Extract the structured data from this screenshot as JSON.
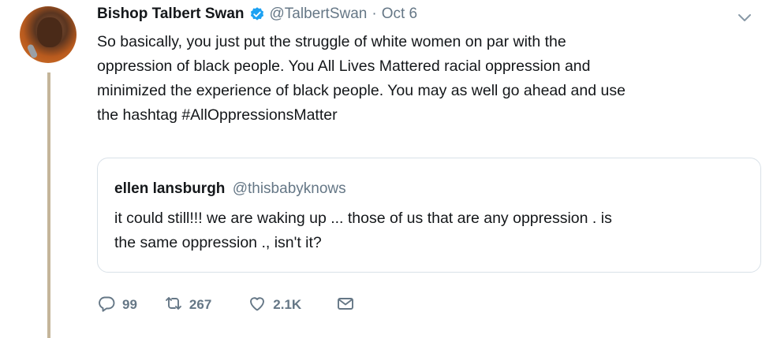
{
  "author": {
    "name": "Bishop Talbert Swan",
    "handle": "@TalbertSwan",
    "separator": "·",
    "date": "Oct 6"
  },
  "tweet": {
    "lines": [
      "So basically, you just put the struggle of white women on par with the",
      "oppression of black people. You All Lives Mattered racial oppression and",
      "minimized the experience of black people. You may as well go ahead and use",
      "the hashtag #AllOppressionsMatter"
    ]
  },
  "quoted": {
    "name": "ellen lansburgh",
    "handle": "@thisbabyknows",
    "lines": [
      "it could still!!! we are waking up ... those of us that are any oppression . is",
      "the same oppression ., isn't it?"
    ]
  },
  "actions": {
    "replies": "99",
    "retweets": "267",
    "likes": "2.1K"
  },
  "colors": {
    "verified": "#1da1f2",
    "muted": "#657786",
    "thread_line": "#c4b59a",
    "border": "#d9e1e8"
  },
  "icons": [
    "verified-badge-icon",
    "chevron-down-icon",
    "reply-icon",
    "retweet-icon",
    "like-icon",
    "message-icon"
  ]
}
